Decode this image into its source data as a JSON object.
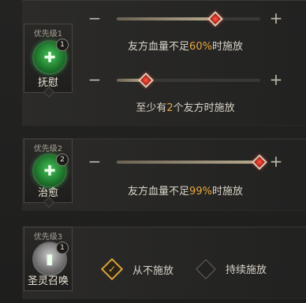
{
  "skills": [
    {
      "priority": "优先级1",
      "name": "抚慰",
      "badge": "1",
      "icon": "healing-cross-icon",
      "conditions": [
        {
          "prefix": "友方血量不足",
          "value": "60%",
          "suffix": "时施放",
          "level": 0.68
        },
        {
          "prefix": "至少有",
          "value": "2",
          "suffix": "个友方时施放",
          "level": 0.2
        }
      ]
    },
    {
      "priority": "优先级2",
      "name": "治愈",
      "badge": "2",
      "icon": "healing-multi-cross-icon",
      "conditions": [
        {
          "prefix": "友方血量不足",
          "value": "99%",
          "suffix": "时施放",
          "level": 0.99
        }
      ]
    },
    {
      "priority": "优先级3",
      "name": "圣灵召唤",
      "badge": "1",
      "icon": "stone-pillar-icon",
      "options": [
        {
          "label": "从不施放",
          "checked": true
        },
        {
          "label": "持续施放",
          "checked": false
        }
      ]
    }
  ],
  "colors": {
    "highlight": "#e6a93a",
    "thumb": "#d8372a",
    "check": "#d9a43a"
  }
}
